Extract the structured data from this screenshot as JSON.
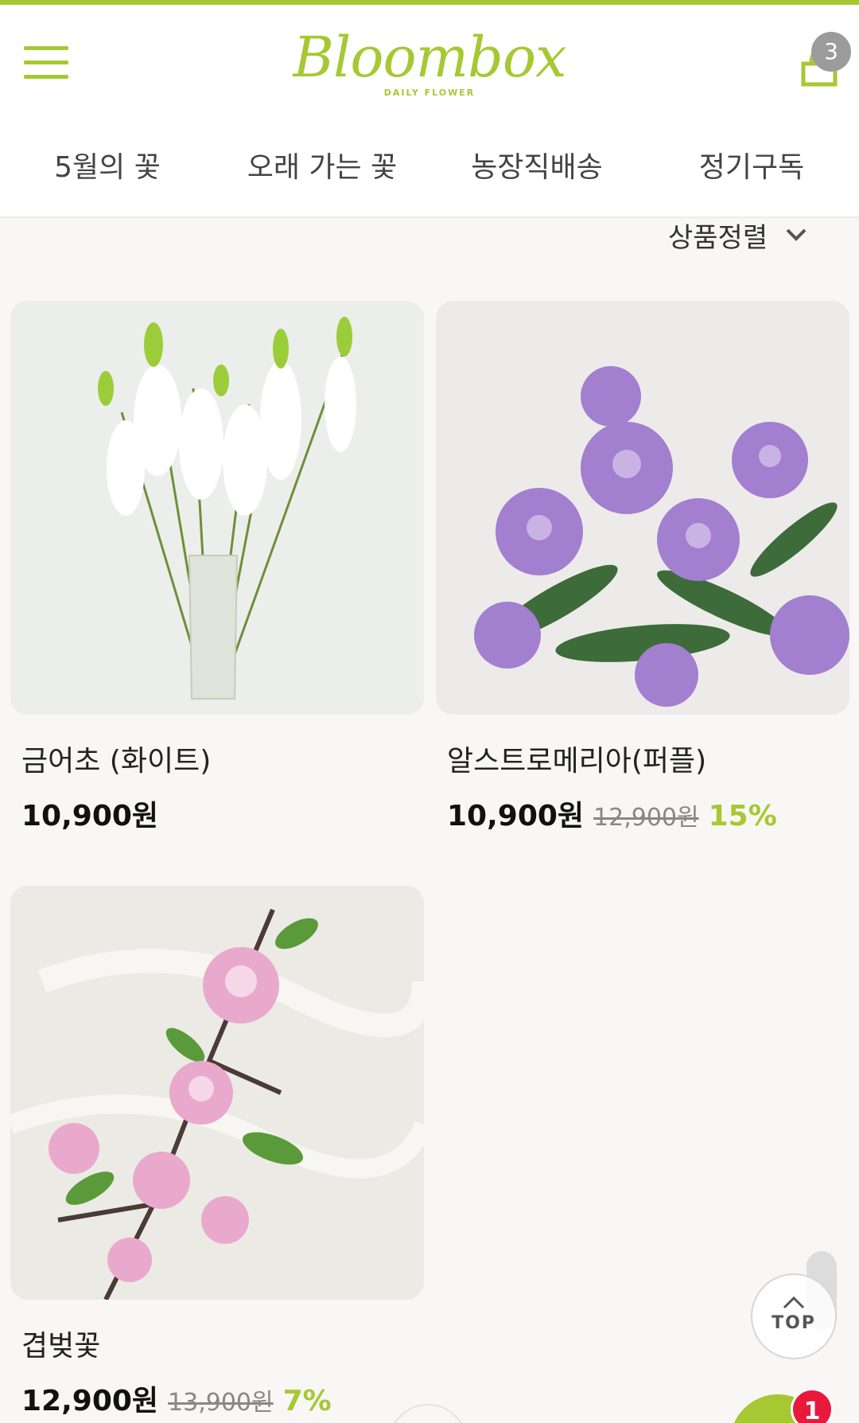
{
  "app": {
    "logo_main": "Bloombox",
    "logo_sub": "DAILY FLOWER",
    "accent": "#a6c832"
  },
  "header": {
    "cart_count": "3"
  },
  "nav": {
    "items": [
      "5월의 꽃",
      "오래 가는 꽃",
      "농장직배송",
      "정기구독"
    ]
  },
  "sort": {
    "label": "상품정렬"
  },
  "products": [
    {
      "name": "금어초 (화이트)",
      "price": "10,900원",
      "old_price": "",
      "discount": ""
    },
    {
      "name": "알스트로메리아(퍼플)",
      "price": "10,900원",
      "old_price": "12,900원",
      "discount": "15%"
    },
    {
      "name": "겹벚꽃",
      "price": "12,900원",
      "old_price": "13,900원",
      "discount": "7%"
    }
  ],
  "top_button": {
    "label": "TOP"
  },
  "chat": {
    "badge": "1"
  }
}
